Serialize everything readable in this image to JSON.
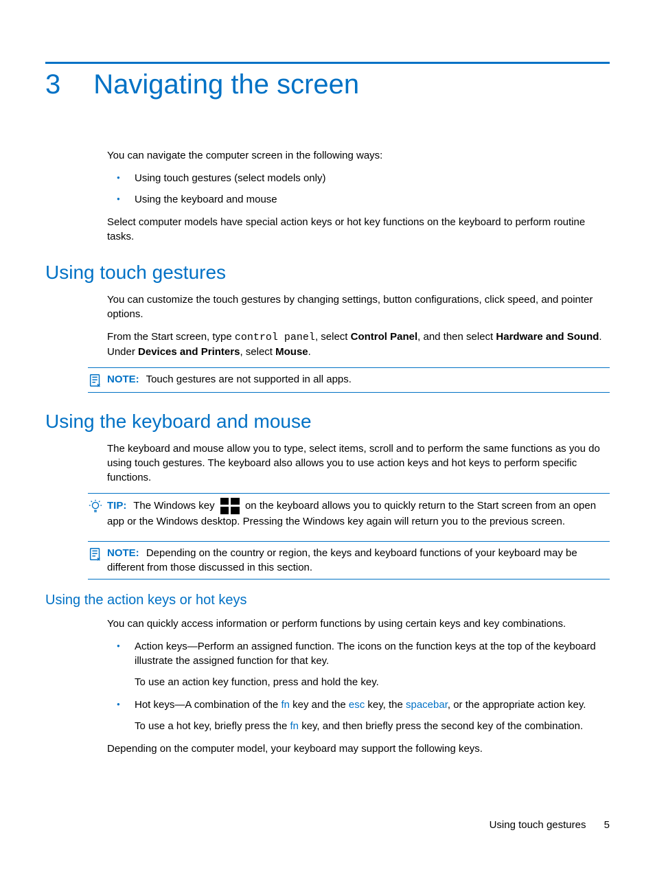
{
  "chapter": {
    "number": "3",
    "title": "Navigating the screen"
  },
  "intro": {
    "p1": "You can navigate the computer screen in the following ways:",
    "bullets": [
      "Using touch gestures (select models only)",
      "Using the keyboard and mouse"
    ],
    "p2": "Select computer models have special action keys or hot key functions on the keyboard to perform routine tasks."
  },
  "section1": {
    "heading": "Using touch gestures",
    "p1": "You can customize the touch gestures by changing settings, button configurations, click speed, and pointer options.",
    "p2_a": "From the Start screen, type ",
    "p2_code": "control panel",
    "p2_b": ", select ",
    "p2_bold1": "Control Panel",
    "p2_c": ", and then select ",
    "p2_bold2": "Hardware and Sound",
    "p2_d": ". Under ",
    "p2_bold3": "Devices and Printers",
    "p2_e": ", select ",
    "p2_bold4": "Mouse",
    "p2_f": ".",
    "note_label": "NOTE:",
    "note_text": "Touch gestures are not supported in all apps."
  },
  "section2": {
    "heading": "Using the keyboard and mouse",
    "p1": "The keyboard and mouse allow you to type, select items, scroll and to perform the same functions as you do using touch gestures. The keyboard also allows you to use action keys and hot keys to perform specific functions.",
    "tip_label": "TIP:",
    "tip_a": "The Windows key ",
    "tip_b": " on the keyboard allows you to quickly return to the Start screen from an open app or the Windows desktop. Pressing the Windows key again will return you to the previous screen.",
    "note_label": "NOTE:",
    "note_text": "Depending on the country or region, the keys and keyboard functions of your keyboard may be different from those discussed in this section."
  },
  "section3": {
    "heading": "Using the action keys or hot keys",
    "p1": "You can quickly access information or perform functions by using certain keys and key combinations.",
    "bullet1": {
      "main": "Action keys—Perform an assigned function. The icons on the function keys at the top of the keyboard illustrate the assigned function for that key.",
      "sub": "To use an action key function, press and hold the key."
    },
    "bullet2": {
      "a": "Hot keys—A combination of the ",
      "k1": "fn",
      "b": " key and the ",
      "k2": "esc",
      "c": " key, the ",
      "k3": "spacebar",
      "d": ", or the appropriate action key.",
      "sub_a": "To use a hot key, briefly press the ",
      "sub_k": "fn",
      "sub_b": " key, and then briefly press the second key of the combination."
    },
    "p2": "Depending on the computer model, your keyboard may support the following keys."
  },
  "footer": {
    "text": "Using touch gestures",
    "page": "5"
  }
}
